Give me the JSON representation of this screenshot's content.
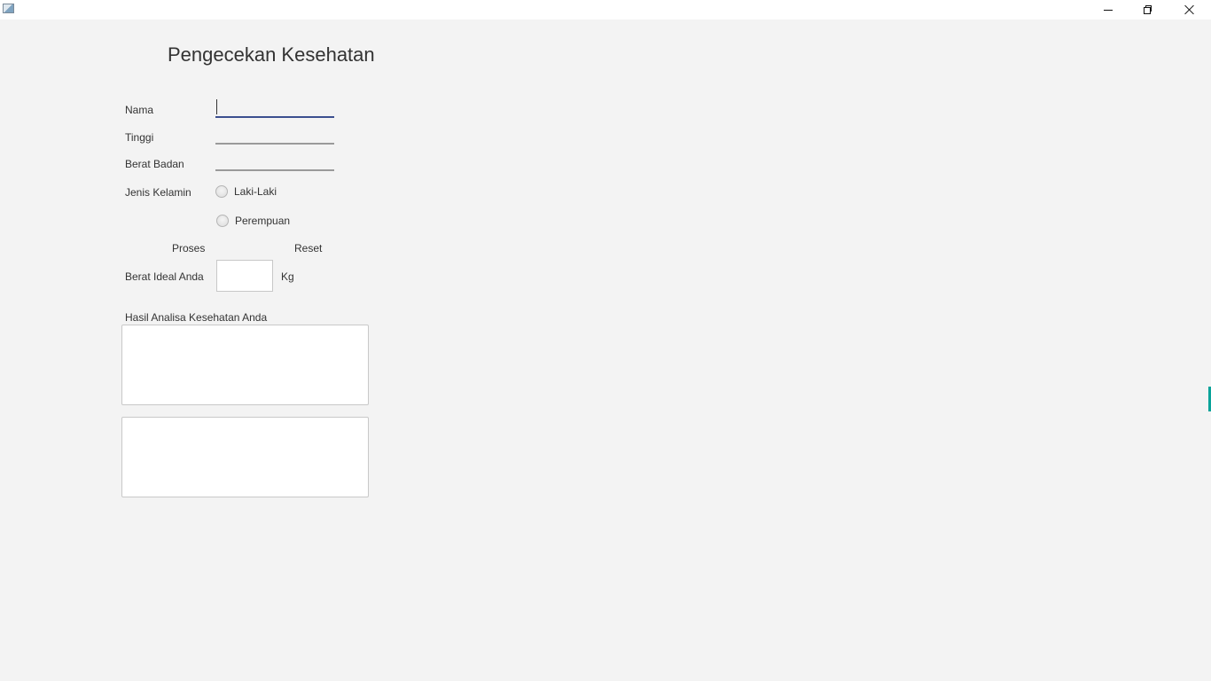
{
  "window": {
    "title": "",
    "controls": {
      "minimize_icon": "minimize-icon",
      "maximize_icon": "restore-icon",
      "close_icon": "close-icon"
    }
  },
  "form": {
    "title": "Pengecekan Kesehatan",
    "fields": {
      "nama": {
        "label": "Nama",
        "value": ""
      },
      "tinggi": {
        "label": "Tinggi",
        "value": ""
      },
      "berat_badan": {
        "label": "Berat Badan",
        "value": ""
      }
    },
    "gender": {
      "label": "Jenis Kelamin",
      "options": [
        "Laki-Laki",
        "Perempuan"
      ]
    },
    "buttons": {
      "proses": "Proses",
      "reset": "Reset"
    },
    "ideal_weight": {
      "label": "Berat Ideal Anda",
      "value": "",
      "unit": "Kg"
    },
    "analysis": {
      "label": "Hasil Analisa Kesehatan Anda",
      "text1": "",
      "text2": ""
    }
  },
  "colors": {
    "background": "#f3f3f3",
    "focus_underline": "#3b4f8f",
    "field_underline": "#9a9a9a",
    "edge_accent": "#0aa39a"
  }
}
